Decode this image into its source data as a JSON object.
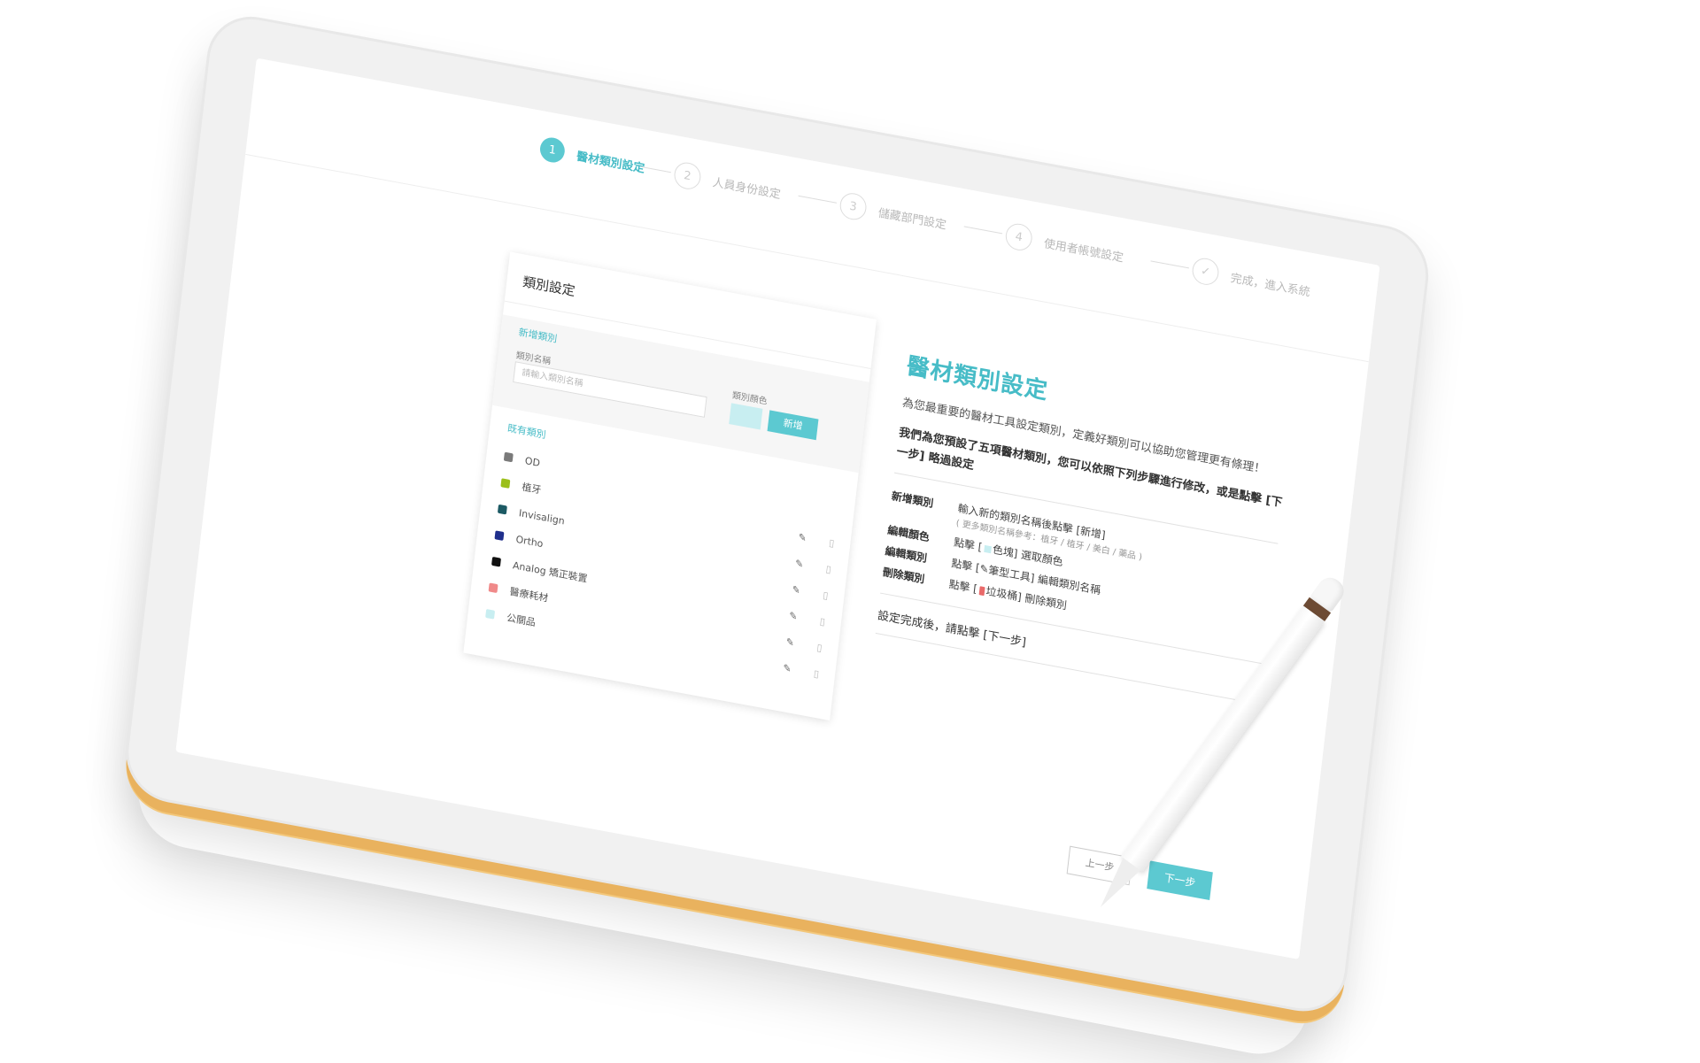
{
  "stepper": {
    "steps": [
      {
        "number": "1",
        "label": "醫材類別設定",
        "state": "active"
      },
      {
        "number": "2",
        "label": "人員身份設定",
        "state": "inactive"
      },
      {
        "number": "3",
        "label": "儲藏部門設定",
        "state": "inactive"
      },
      {
        "number": "4",
        "label": "使用者帳號設定",
        "state": "inactive"
      },
      {
        "number": "✓",
        "label": "完成，進入系統",
        "state": "inactive"
      }
    ]
  },
  "card": {
    "title": "類別設定",
    "add_section_title": "新增類別",
    "name_label": "類別名稱",
    "name_placeholder": "請輸入類別名稱",
    "color_label": "類別顏色",
    "add_button": "新增",
    "existing_title": "既有類別",
    "categories": [
      {
        "name": "OD",
        "color": "#7a7a7a"
      },
      {
        "name": "植牙",
        "color": "#9bbf1a"
      },
      {
        "name": "Invisalign",
        "color": "#1c5a64"
      },
      {
        "name": "Ortho",
        "color": "#1f2f8c"
      },
      {
        "name": "Analog 矯正裝置",
        "color": "#111111"
      },
      {
        "name": "醫療耗材",
        "color": "#f08a8a"
      },
      {
        "name": "公關品",
        "color": "#c8eef1"
      }
    ],
    "edit_icon": "pencil-icon",
    "delete_icon": "trash-icon"
  },
  "help": {
    "title": "醫材類別設定",
    "intro": "為您最重要的醫材工具設定類別，定義好類別可以協助您管理更有條理！",
    "preset": "我們為您預設了五項醫材類別，您可以依照下列步驟進行修改，或是點擊 [下一步] 略過設定",
    "rows": [
      {
        "key": "新增類別",
        "text": "輸入新的類別名稱後點擊 [新增]"
      },
      {
        "key": "編輯顏色",
        "text_before": "點擊 [",
        "text_after": "色塊] 選取顏色"
      },
      {
        "key": "編輯類別",
        "text": "點擊 [✎筆型工具] 編輯類別名稱"
      },
      {
        "key": "刪除類別",
        "text_before": "點擊 [",
        "text_after": "垃圾桶] 刪除類別"
      }
    ],
    "hint": "( 更多類別名稱參考：植牙 / 植牙 / 美白 / 藥品 )",
    "finish": "設定完成後，請點擊 [下一步]"
  },
  "footer": {
    "prev_label": "上一步",
    "next_label": "下一步"
  },
  "colors": {
    "accent": "#5cc9d1",
    "accent_text": "#47bcc7",
    "device_frame": "#f1f1f1",
    "device_edge": "#e9b25e",
    "stylus_band": "#6d4b34"
  }
}
